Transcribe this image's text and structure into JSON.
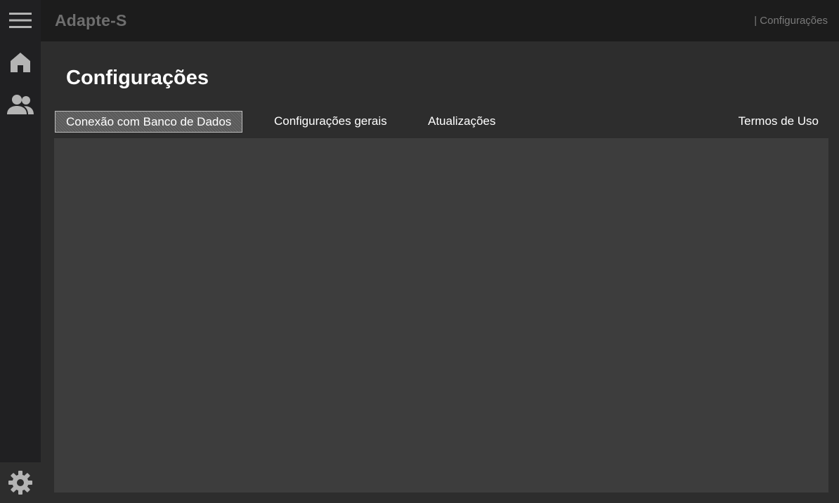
{
  "app": {
    "title": "Adapte-S",
    "breadcrumb": "| Configurações"
  },
  "sidebar": {
    "items": [
      {
        "icon": "hamburger-menu-icon"
      },
      {
        "icon": "home-icon"
      },
      {
        "icon": "users-icon"
      },
      {
        "icon": "gear-icon"
      }
    ]
  },
  "page": {
    "title": "Configurações"
  },
  "tabs": [
    {
      "label": "Conexão com Banco de Dados",
      "active": true
    },
    {
      "label": "Configurações gerais",
      "active": false
    },
    {
      "label": "Atualizações",
      "active": false
    },
    {
      "label": "Termos de Uso",
      "active": false
    }
  ],
  "colors": {
    "sidebar_bg": "#202022",
    "topbar_bg": "#1c1c1c",
    "main_bg": "#2d2d2d",
    "panel_bg": "#3d3d3d",
    "icon_color": "#b4b4b4"
  }
}
